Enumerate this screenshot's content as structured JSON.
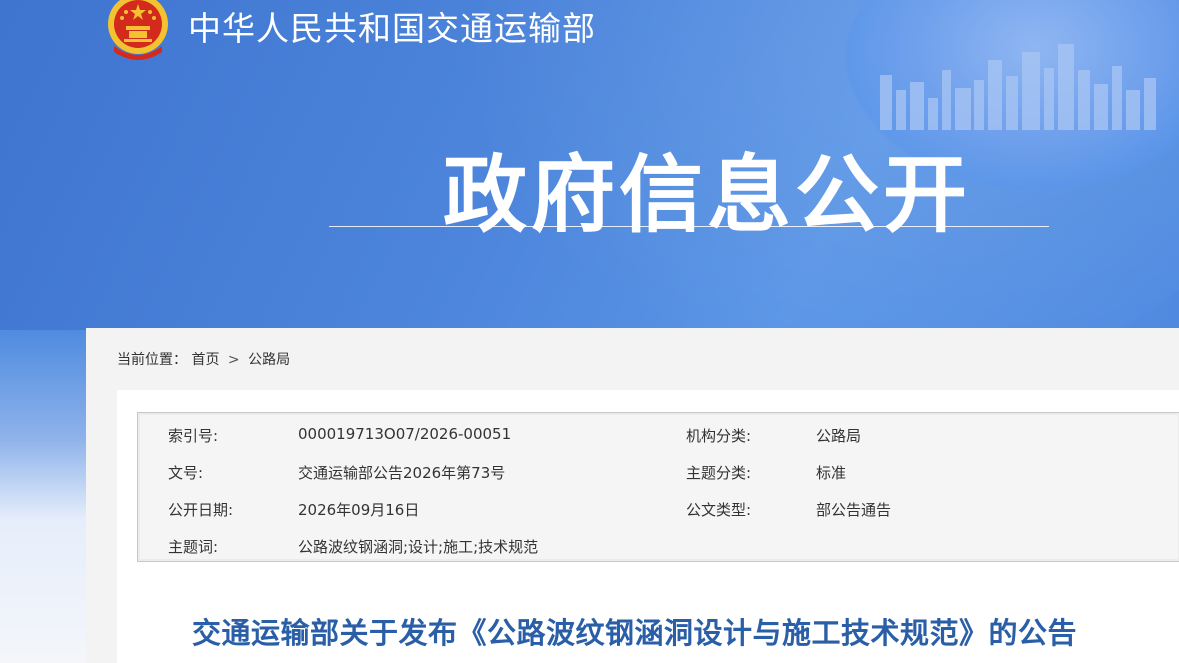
{
  "header": {
    "ministry_name": "中华人民共和国交通运输部",
    "section_title": "政府信息公开"
  },
  "breadcrumb": {
    "prefix": "当前位置：",
    "items": [
      "首页",
      "公路局"
    ],
    "separator": ">"
  },
  "metadata": {
    "index_label": "索引号:",
    "index_value": "000019713O07/2026-00051",
    "agency_label": "机构分类:",
    "agency_value": "公路局",
    "docno_label": "文号:",
    "docno_value": "交通运输部公告2026年第73号",
    "topic_label": "主题分类:",
    "topic_value": "标准",
    "date_label": "公开日期:",
    "date_value": "2026年09月16日",
    "doctype_label": "公文类型:",
    "doctype_value": "部公告通告",
    "keywords_label": "主题词:",
    "keywords_value": "公路波纹钢涵洞;设计;施工;技术规范"
  },
  "article": {
    "title": "交通运输部关于发布《公路波纹钢涵洞设计与施工技术规范》的公告"
  },
  "colors": {
    "banner_blue": "#4a7fd6",
    "title_blue": "#2a5fa8",
    "emblem_red": "#d42a1e",
    "emblem_gold": "#f2c230"
  },
  "icons": {
    "emblem": "national-emblem-icon"
  }
}
